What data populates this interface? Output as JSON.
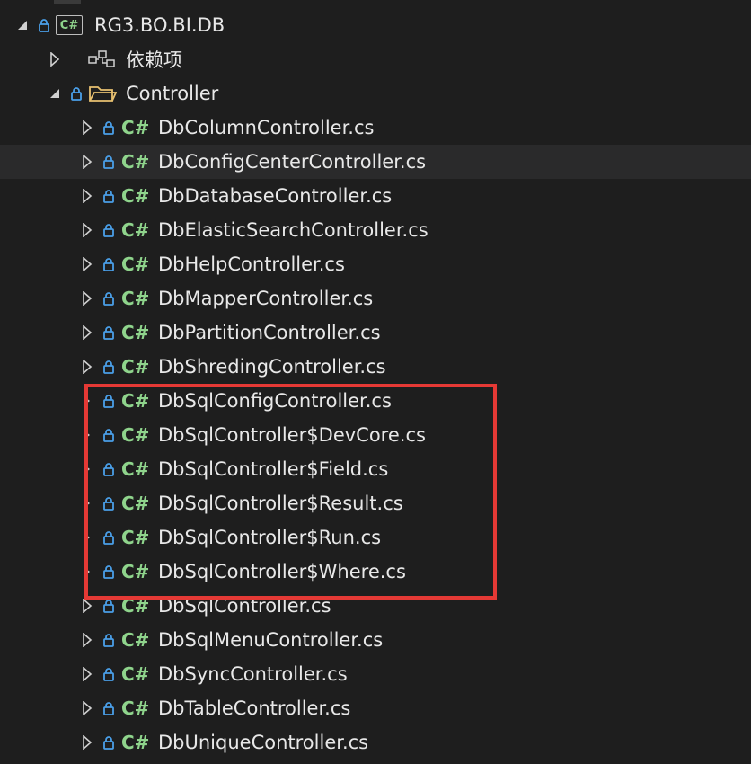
{
  "project": {
    "name": "RG3.BO.BI.DB",
    "badge": "C#"
  },
  "dependencies": {
    "label": "依赖项"
  },
  "folder": {
    "label": "Controller"
  },
  "file_badge": "C#",
  "files": [
    "DbColumnController.cs",
    "DbConfigCenterController.cs",
    "DbDatabaseController.cs",
    "DbElasticSearchController.cs",
    "DbHelpController.cs",
    "DbMapperController.cs",
    "DbPartitionController.cs",
    "DbShredingController.cs",
    "DbSqlConfigController.cs",
    "DbSqlController$DevCore.cs",
    "DbSqlController$Field.cs",
    "DbSqlController$Result.cs",
    "DbSqlController$Run.cs",
    "DbSqlController$Where.cs",
    "DbSqlController.cs",
    "DbSqlMenuController.cs",
    "DbSyncController.cs",
    "DbTableController.cs",
    "DbUniqueController.cs"
  ],
  "colors": {
    "lock": "#4a9fe8",
    "csharp": "#8fd48c",
    "highlight": "#e53935",
    "selected_row": "#2a2a2b",
    "folder": "#e8c170"
  }
}
